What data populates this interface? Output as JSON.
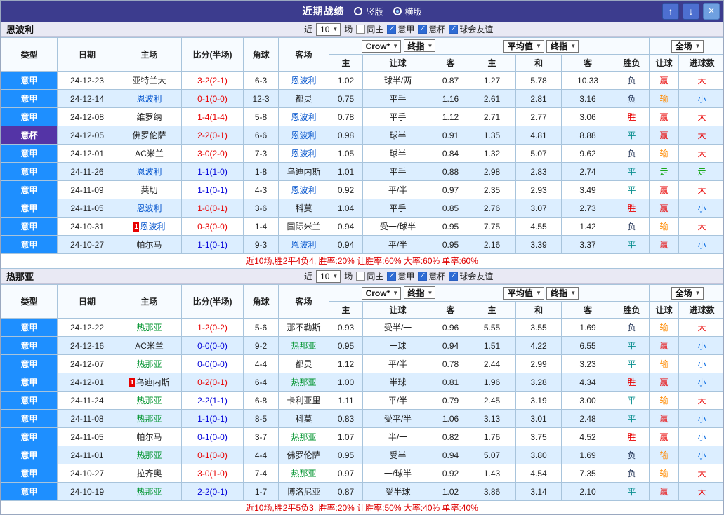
{
  "titlebar": {
    "title": "近期战绩",
    "vertical": "竖版",
    "horizontal": "横版",
    "up_icon": "↑",
    "down_icon": "↓",
    "close_icon": "×"
  },
  "filters": {
    "near": "近",
    "count": "10",
    "games": "场",
    "opts": [
      "同主",
      "意甲",
      "意杯",
      "球会友谊"
    ],
    "checked": [
      false,
      true,
      true,
      true
    ]
  },
  "header": {
    "type": "类型",
    "date": "日期",
    "home": "主场",
    "score": "比分(半场)",
    "corners": "角球",
    "away": "客场",
    "crow": "Crow*",
    "final": "终指",
    "avg": "平均值",
    "full": "全场",
    "home_col": "主",
    "handicap_col": "让球",
    "away_col": "客",
    "draw_col": "和",
    "result_col": "胜负",
    "goals_col": "进球数"
  },
  "colors": {
    "titlebar_bg": "#3c3c8e",
    "serie_a_badge": "#1e8fff",
    "coppa_badge": "#5434a6",
    "empoli_name": "#0052cc",
    "genoa_name": "#00942e",
    "score_decisive": "#e80000",
    "score_draw": "#0000d8",
    "alt_row": "#dceeff"
  },
  "sections": [
    {
      "team": "恩波利",
      "team_color": "#0052cc",
      "footer": "近10场,胜2平4负4, 胜率:20% 让胜率:60% 大率:60% 单率:60%",
      "rows": [
        {
          "league": "意甲",
          "date": "24-12-23",
          "home": {
            "text": "亚特兰大"
          },
          "score": "3-2(2-1)",
          "score_color": "red",
          "corners": "6-3",
          "away": {
            "text": "恩波利",
            "focus": true
          },
          "odds": [
            "1.02",
            "球半/两",
            "0.87",
            "1.27",
            "5.78",
            "10.33"
          ],
          "result": "负",
          "handicap_result": "赢",
          "goals": "大"
        },
        {
          "league": "意甲",
          "date": "24-12-14",
          "home": {
            "text": "恩波利",
            "focus": true
          },
          "score": "0-1(0-0)",
          "score_color": "red",
          "corners": "12-3",
          "away": {
            "text": "都灵"
          },
          "odds": [
            "0.75",
            "平手",
            "1.16",
            "2.61",
            "2.81",
            "3.16"
          ],
          "result": "负",
          "handicap_result": "输",
          "goals": "小"
        },
        {
          "league": "意甲",
          "date": "24-12-08",
          "home": {
            "text": "维罗纳"
          },
          "score": "1-4(1-4)",
          "score_color": "red",
          "corners": "5-8",
          "away": {
            "text": "恩波利",
            "focus": true
          },
          "odds": [
            "0.78",
            "平手",
            "1.12",
            "2.71",
            "2.77",
            "3.06"
          ],
          "result": "胜",
          "handicap_result": "赢",
          "goals": "大"
        },
        {
          "league": "意杯",
          "date": "24-12-05",
          "home": {
            "text": "佛罗伦萨"
          },
          "score": "2-2(0-1)",
          "score_color": "red",
          "corners": "6-6",
          "away": {
            "text": "恩波利",
            "focus": true
          },
          "odds": [
            "0.98",
            "球半",
            "0.91",
            "1.35",
            "4.81",
            "8.88"
          ],
          "result": "平",
          "handicap_result": "赢",
          "goals": "大"
        },
        {
          "league": "意甲",
          "date": "24-12-01",
          "home": {
            "text": "AC米兰"
          },
          "score": "3-0(2-0)",
          "score_color": "red",
          "corners": "7-3",
          "away": {
            "text": "恩波利",
            "focus": true
          },
          "odds": [
            "1.05",
            "球半",
            "0.84",
            "1.32",
            "5.07",
            "9.62"
          ],
          "result": "负",
          "handicap_result": "输",
          "goals": "大"
        },
        {
          "league": "意甲",
          "date": "24-11-26",
          "home": {
            "text": "恩波利",
            "focus": true
          },
          "score": "1-1(1-0)",
          "score_color": "blue",
          "corners": "1-8",
          "away": {
            "text": "乌迪内斯"
          },
          "odds": [
            "1.01",
            "平手",
            "0.88",
            "2.98",
            "2.83",
            "2.74"
          ],
          "result": "平",
          "handicap_result": "走",
          "goals": "走"
        },
        {
          "league": "意甲",
          "date": "24-11-09",
          "home": {
            "text": "莱切"
          },
          "score": "1-1(0-1)",
          "score_color": "blue",
          "corners": "4-3",
          "away": {
            "text": "恩波利",
            "focus": true
          },
          "odds": [
            "0.92",
            "平/半",
            "0.97",
            "2.35",
            "2.93",
            "3.49"
          ],
          "result": "平",
          "handicap_result": "赢",
          "goals": "大"
        },
        {
          "league": "意甲",
          "date": "24-11-05",
          "home": {
            "text": "恩波利",
            "focus": true
          },
          "score": "1-0(0-1)",
          "score_color": "red",
          "corners": "3-6",
          "away": {
            "text": "科莫"
          },
          "odds": [
            "1.04",
            "平手",
            "0.85",
            "2.76",
            "3.07",
            "2.73"
          ],
          "result": "胜",
          "handicap_result": "赢",
          "goals": "小"
        },
        {
          "league": "意甲",
          "date": "24-10-31",
          "home": {
            "text": "恩波利",
            "focus": true,
            "red_card": true
          },
          "score": "0-3(0-0)",
          "score_color": "red",
          "corners": "1-4",
          "away": {
            "text": "国际米兰"
          },
          "odds": [
            "0.94",
            "受一/球半",
            "0.95",
            "7.75",
            "4.55",
            "1.42"
          ],
          "result": "负",
          "handicap_result": "输",
          "goals": "大"
        },
        {
          "league": "意甲",
          "date": "24-10-27",
          "home": {
            "text": "帕尔马"
          },
          "score": "1-1(0-1)",
          "score_color": "blue",
          "corners": "9-3",
          "away": {
            "text": "恩波利",
            "focus": true
          },
          "odds": [
            "0.94",
            "平/半",
            "0.95",
            "2.16",
            "3.39",
            "3.37"
          ],
          "result": "平",
          "handicap_result": "赢",
          "goals": "小"
        }
      ]
    },
    {
      "team": "热那亚",
      "team_color": "#00942e",
      "footer": "近10场,胜2平5负3, 胜率:20% 让胜率:50% 大率:40% 单率:40%",
      "rows": [
        {
          "league": "意甲",
          "date": "24-12-22",
          "home": {
            "text": "热那亚",
            "focus": true
          },
          "score": "1-2(0-2)",
          "score_color": "red",
          "corners": "5-6",
          "away": {
            "text": "那不勒斯"
          },
          "odds": [
            "0.93",
            "受半/一",
            "0.96",
            "5.55",
            "3.55",
            "1.69"
          ],
          "result": "负",
          "handicap_result": "输",
          "goals": "大"
        },
        {
          "league": "意甲",
          "date": "24-12-16",
          "home": {
            "text": "AC米兰"
          },
          "score": "0-0(0-0)",
          "score_color": "blue",
          "corners": "9-2",
          "away": {
            "text": "热那亚",
            "focus": true
          },
          "odds": [
            "0.95",
            "一球",
            "0.94",
            "1.51",
            "4.22",
            "6.55"
          ],
          "result": "平",
          "handicap_result": "赢",
          "goals": "小"
        },
        {
          "league": "意甲",
          "date": "24-12-07",
          "home": {
            "text": "热那亚",
            "focus": true
          },
          "score": "0-0(0-0)",
          "score_color": "blue",
          "corners": "4-4",
          "away": {
            "text": "都灵"
          },
          "odds": [
            "1.12",
            "平/半",
            "0.78",
            "2.44",
            "2.99",
            "3.23"
          ],
          "result": "平",
          "handicap_result": "输",
          "goals": "小"
        },
        {
          "league": "意甲",
          "date": "24-12-01",
          "home": {
            "text": "乌迪内斯",
            "red_card": true
          },
          "score": "0-2(0-1)",
          "score_color": "red",
          "corners": "6-4",
          "away": {
            "text": "热那亚",
            "focus": true
          },
          "odds": [
            "1.00",
            "半球",
            "0.81",
            "1.96",
            "3.28",
            "4.34"
          ],
          "result": "胜",
          "handicap_result": "赢",
          "goals": "小"
        },
        {
          "league": "意甲",
          "date": "24-11-24",
          "home": {
            "text": "热那亚",
            "focus": true
          },
          "score": "2-2(1-1)",
          "score_color": "blue",
          "corners": "6-8",
          "away": {
            "text": "卡利亚里"
          },
          "odds": [
            "1.11",
            "平/半",
            "0.79",
            "2.45",
            "3.19",
            "3.00"
          ],
          "result": "平",
          "handicap_result": "输",
          "goals": "大"
        },
        {
          "league": "意甲",
          "date": "24-11-08",
          "home": {
            "text": "热那亚",
            "focus": true
          },
          "score": "1-1(0-1)",
          "score_color": "blue",
          "corners": "8-5",
          "away": {
            "text": "科莫"
          },
          "odds": [
            "0.83",
            "受平/半",
            "1.06",
            "3.13",
            "3.01",
            "2.48"
          ],
          "result": "平",
          "handicap_result": "赢",
          "goals": "小"
        },
        {
          "league": "意甲",
          "date": "24-11-05",
          "home": {
            "text": "帕尔马"
          },
          "score": "0-1(0-0)",
          "score_color": "blue",
          "corners": "3-7",
          "away": {
            "text": "热那亚",
            "focus": true
          },
          "odds": [
            "1.07",
            "半/一",
            "0.82",
            "1.76",
            "3.75",
            "4.52"
          ],
          "result": "胜",
          "handicap_result": "赢",
          "goals": "小"
        },
        {
          "league": "意甲",
          "date": "24-11-01",
          "home": {
            "text": "热那亚",
            "focus": true
          },
          "score": "0-1(0-0)",
          "score_color": "red",
          "corners": "4-4",
          "away": {
            "text": "佛罗伦萨"
          },
          "odds": [
            "0.95",
            "受半",
            "0.94",
            "5.07",
            "3.80",
            "1.69"
          ],
          "result": "负",
          "handicap_result": "输",
          "goals": "小"
        },
        {
          "league": "意甲",
          "date": "24-10-27",
          "home": {
            "text": "拉齐奥"
          },
          "score": "3-0(1-0)",
          "score_color": "red",
          "corners": "7-4",
          "away": {
            "text": "热那亚",
            "focus": true
          },
          "odds": [
            "0.97",
            "一/球半",
            "0.92",
            "1.43",
            "4.54",
            "7.35"
          ],
          "result": "负",
          "handicap_result": "输",
          "goals": "大"
        },
        {
          "league": "意甲",
          "date": "24-10-19",
          "home": {
            "text": "热那亚",
            "focus": true
          },
          "score": "2-2(0-1)",
          "score_color": "blue",
          "corners": "1-7",
          "away": {
            "text": "博洛尼亚"
          },
          "odds": [
            "0.87",
            "受半球",
            "1.02",
            "3.86",
            "3.14",
            "2.10"
          ],
          "result": "平",
          "handicap_result": "赢",
          "goals": "大"
        }
      ]
    }
  ]
}
